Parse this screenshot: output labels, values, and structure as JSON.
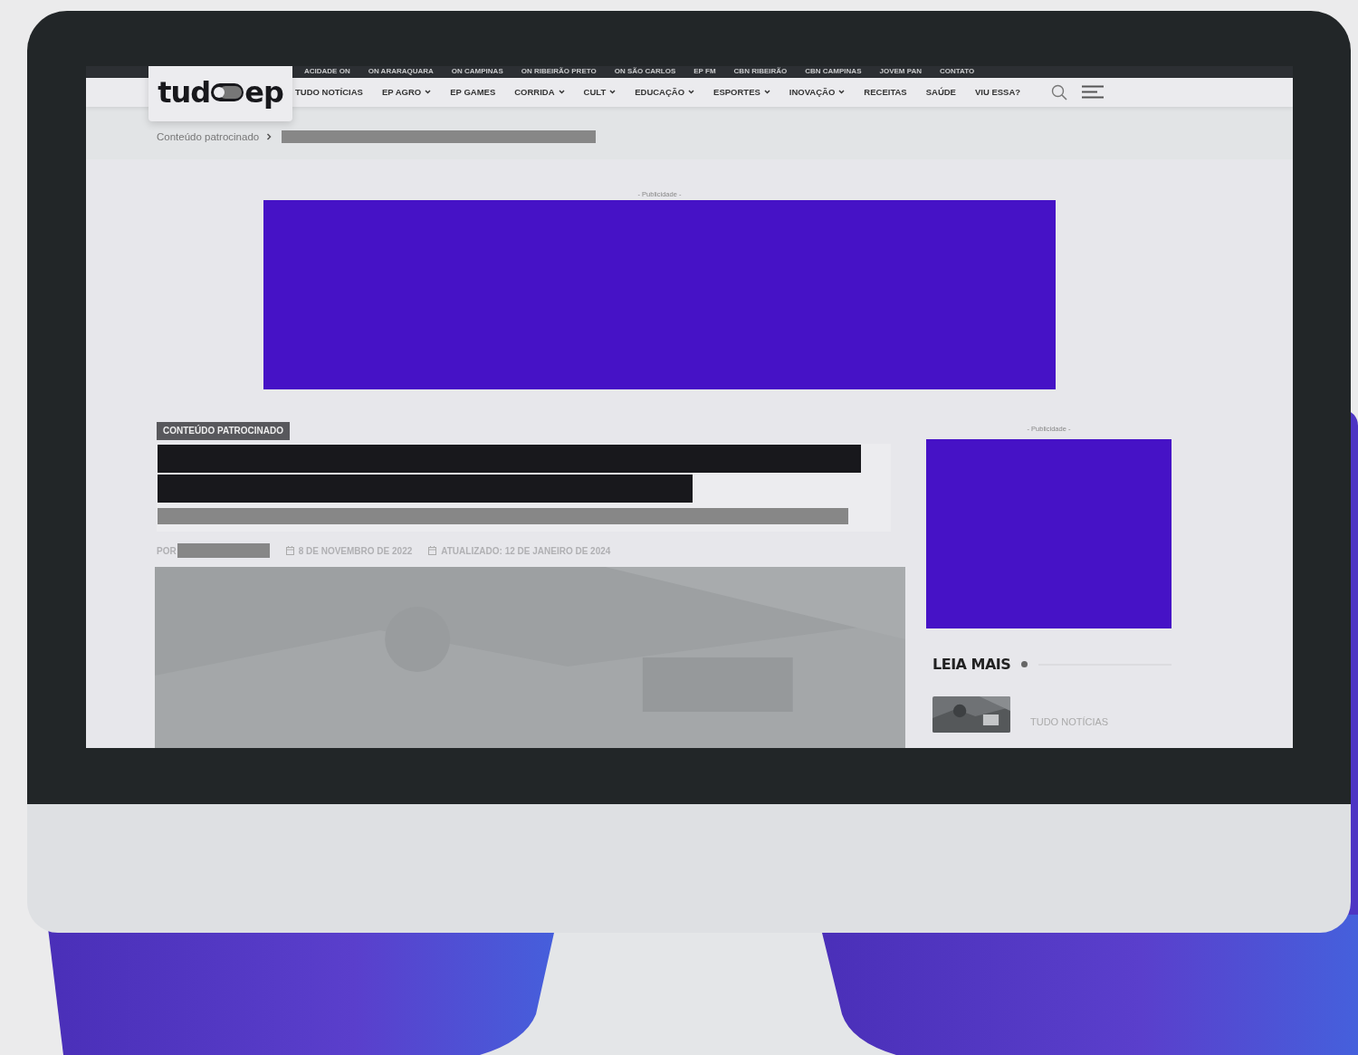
{
  "top_links": [
    "ACIDADE ON",
    "ON ARARAQUARA",
    "ON CAMPINAS",
    "ON RIBEIRÃO PRETO",
    "ON SÃO CARLOS",
    "EP FM",
    "CBN RIBEIRÃO",
    "CBN CAMPINAS",
    "JOVEM PAN",
    "CONTATO"
  ],
  "logo": {
    "left": "tud",
    "right": "ep"
  },
  "nav": [
    {
      "label": "TUDO NOTÍCIAS",
      "has_menu": false
    },
    {
      "label": "EP AGRO",
      "has_menu": true
    },
    {
      "label": "EP GAMES",
      "has_menu": false
    },
    {
      "label": "CORRIDA",
      "has_menu": true
    },
    {
      "label": "CULT",
      "has_menu": true
    },
    {
      "label": "EDUCAÇÃO",
      "has_menu": true
    },
    {
      "label": "ESPORTES",
      "has_menu": true
    },
    {
      "label": "INOVAÇÃO",
      "has_menu": true
    },
    {
      "label": "RECEITAS",
      "has_menu": false
    },
    {
      "label": "SAÚDE",
      "has_menu": false
    },
    {
      "label": "VIU ESSA?",
      "has_menu": false
    }
  ],
  "breadcrumb": {
    "label": "Conteúdo patrocinado"
  },
  "top_ad": {
    "label": "- Publicidade -"
  },
  "article": {
    "tag": "CONTEÚDO PATROCINADO",
    "byline_prefix": "POR",
    "published": "8 DE NOVEMBRO DE 2022",
    "updated": "ATUALIZADO: 12 DE JANEIRO DE 2024"
  },
  "sidebar": {
    "ad_label": "- Publicidade -",
    "section_title": "LEIA MAIS",
    "items": [
      {
        "category": "TUDO NOTÍCIAS"
      }
    ]
  }
}
